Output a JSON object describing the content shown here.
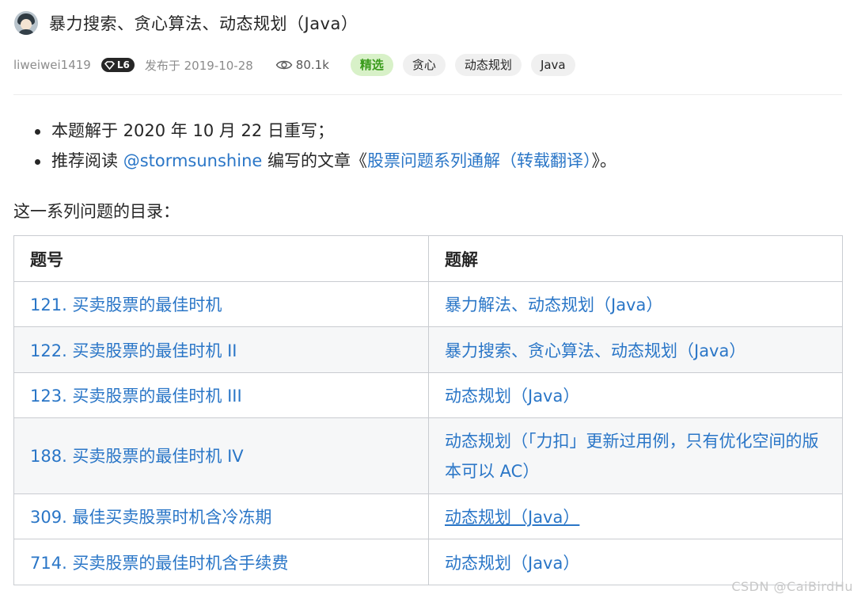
{
  "post": {
    "title": "暴力搜索、贪心算法、动态规划（Java）",
    "author": "liweiwei1419",
    "level": "L6",
    "published": "发布于 2019-10-28",
    "views": "80.1k",
    "tags": [
      "精选",
      "贪心",
      "动态规划",
      "Java"
    ]
  },
  "bullets": [
    {
      "text": "本题解于 2020 年 10 月 22 日重写；"
    },
    {
      "prefix": "推荐阅读 ",
      "mention": "@stormsunshine",
      "middle": " 编写的文章《",
      "article": "股票问题系列通解（转载翻译）",
      "suffix": "》。"
    }
  ],
  "intro": "这一系列问题的目录：",
  "table": {
    "headers": [
      "题号",
      "题解"
    ],
    "rows": [
      [
        "121. 买卖股票的最佳时机",
        "暴力解法、动态规划（Java）"
      ],
      [
        "122. 买卖股票的最佳时机 II",
        "暴力搜索、贪心算法、动态规划（Java）"
      ],
      [
        "123. 买卖股票的最佳时机 III",
        "动态规划（Java）"
      ],
      [
        "188. 买卖股票的最佳时机 IV",
        "动态规划（「力扣」更新过用例，只有优化空间的版本可以 AC）"
      ],
      [
        "309. 最佳买卖股票时机含冷冻期",
        "动态规划（Java）"
      ],
      [
        "714. 买卖股票的最佳时机含手续费",
        "动态规划（Java）"
      ]
    ]
  },
  "watermark": "CSDN @CaiBirdHu",
  "colors": {
    "link": "#2a76c7",
    "featured_bg": "#d8f1c8",
    "featured_text": "#3a9b1c"
  },
  "icons": [
    "avatar",
    "level-diamond-icon",
    "eye-icon"
  ]
}
